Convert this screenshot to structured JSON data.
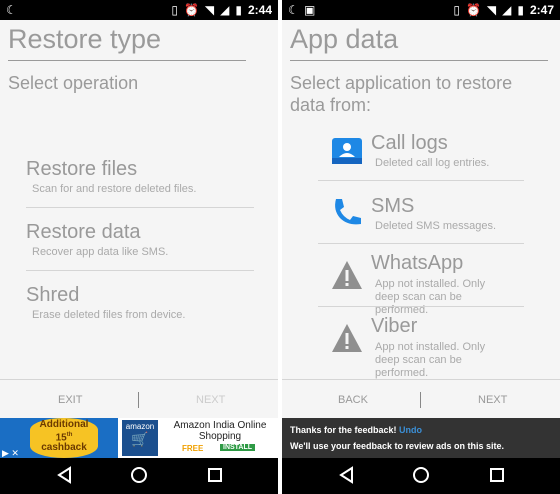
{
  "left": {
    "status": {
      "time": "2:44"
    },
    "title": "Restore type",
    "subtitle": "Select operation",
    "operations": [
      {
        "label": "Restore files",
        "desc": "Scan for and restore deleted files."
      },
      {
        "label": "Restore data",
        "desc": "Recover app data like SMS."
      },
      {
        "label": "Shred",
        "desc": "Erase deleted files from device."
      }
    ],
    "buttons": {
      "exit": "EXIT",
      "next": "NEXT"
    },
    "ad": {
      "badge_line1": "Additional",
      "badge_line2": "15",
      "badge_sup": "th",
      "badge_line3": "cashback",
      "logo": "amazon",
      "title": "Amazon India Online Shopping",
      "free": "FREE",
      "install": "INSTALL"
    }
  },
  "right": {
    "status": {
      "time": "2:47"
    },
    "title": "App data",
    "subtitle": "Select application to restore data from:",
    "apps": [
      {
        "label": "Call logs",
        "desc": "Deleted call log entries.",
        "icon": "contact-card-icon"
      },
      {
        "label": "SMS",
        "desc": "Deleted SMS messages.",
        "icon": "phone-handset-icon"
      },
      {
        "label": "WhatsApp",
        "desc": "App not installed. Only deep scan can be performed.",
        "icon": "warning-icon"
      },
      {
        "label": "Viber",
        "desc": "App not installed. Only deep scan can be performed.",
        "icon": "warning-icon"
      }
    ],
    "buttons": {
      "back": "BACK",
      "next": "NEXT"
    },
    "toast": {
      "text1": "Thanks for the feedback!",
      "undo": "Undo",
      "text2": "We'll use your feedback to review ads on this site."
    }
  },
  "colors": {
    "accent_blue": "#1e88e5",
    "warning_gray": "#8f8f8f",
    "install_green": "#2e9a45"
  }
}
